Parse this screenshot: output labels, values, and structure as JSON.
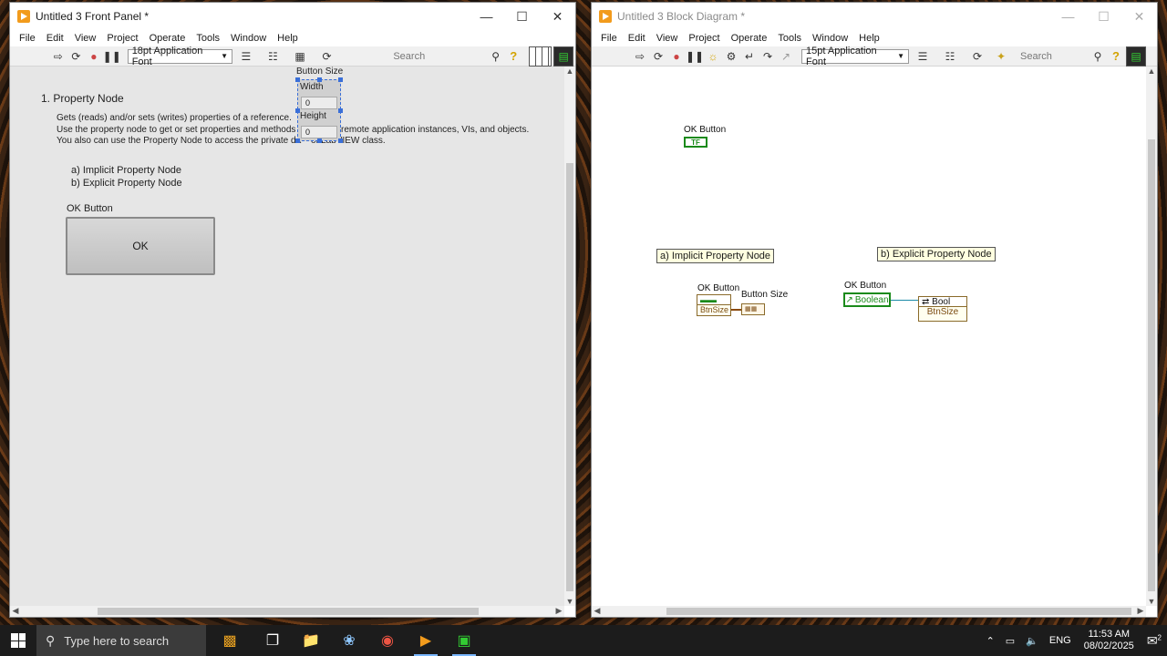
{
  "front_panel": {
    "title": "Untitled 3 Front Panel *",
    "menu": [
      "File",
      "Edit",
      "View",
      "Project",
      "Operate",
      "Tools",
      "Window",
      "Help"
    ],
    "font_select": "18pt Application Font",
    "search_placeholder": "Search",
    "heading": "1. Property Node",
    "desc_line1": "Gets (reads) and/or sets (writes) properties of a reference.",
    "desc_line2a": "Use the property node to get or set properties and methods o",
    "desc_line2b": "remote application instances, VIs, and objects.",
    "desc_line3a": "You also can use the Property Node to access the private da",
    "desc_line3b": "of LabVIEW class.",
    "item_a": "a) Implicit Property Node",
    "item_b": "b) Explicit Property Node",
    "ok_label": "OK Button",
    "ok_text": "OK",
    "cluster": {
      "label": "Button Size",
      "width_label": "Width",
      "width_value": "0",
      "height_label": "Height",
      "height_value": "0"
    }
  },
  "block_diagram": {
    "title": "Untitled 3 Block Diagram *",
    "menu": [
      "File",
      "Edit",
      "View",
      "Project",
      "Operate",
      "Tools",
      "Window",
      "Help"
    ],
    "font_select": "15pt Application Font",
    "search_placeholder": "Search",
    "ok_terminal_label": "OK Button",
    "ok_terminal_text": "TF",
    "implicit_label": "a) Implicit Property Node",
    "explicit_label": "b) Explicit Property Node",
    "implicit_node_label": "OK Button",
    "implicit_prop": "BtnSize",
    "implicit_out_label": "Button Size",
    "explicit_ref_label": "OK Button",
    "explicit_ref_text": "Boolean",
    "explicit_class": "Bool",
    "explicit_prop": "BtnSize"
  },
  "taskbar": {
    "search_placeholder": "Type here to search",
    "lang": "ENG",
    "time": "11:53 AM",
    "date": "08/02/2025",
    "notif_count": "2"
  }
}
